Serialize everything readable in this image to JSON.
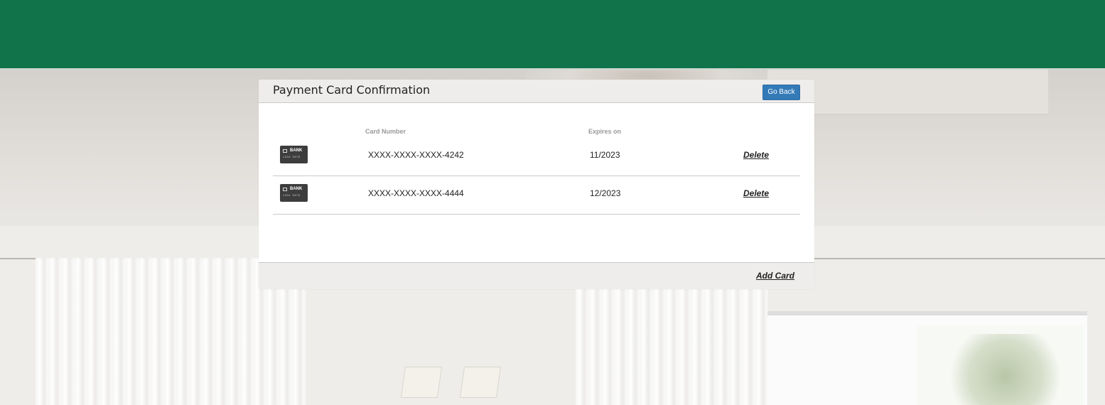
{
  "header": {
    "brand_color": "#10734a"
  },
  "panel": {
    "title": "Payment Card Confirmation",
    "go_back_label": "Go Back",
    "columns": {
      "card_number": "Card Number",
      "expires_on": "Expires on"
    },
    "cards": [
      {
        "icon": "bank-card-icon",
        "brand": "BANK",
        "icon_digits": "1234 5678",
        "number": "XXXX-XXXX-XXXX-4242",
        "expires": "11/2023",
        "action": "Delete"
      },
      {
        "icon": "bank-card-icon",
        "brand": "BANK",
        "icon_digits": "1234 5678",
        "number": "XXXX-XXXX-XXXX-4444",
        "expires": "12/2023",
        "action": "Delete"
      }
    ],
    "add_card_label": "Add Card"
  },
  "colors": {
    "button": "#337ab7",
    "text": "#222222",
    "muted": "#999999"
  }
}
